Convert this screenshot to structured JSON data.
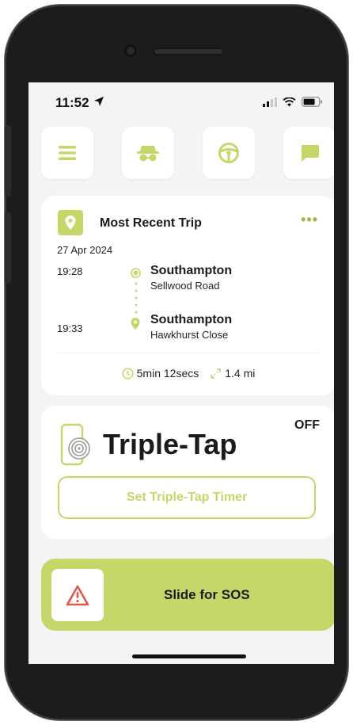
{
  "status_bar": {
    "time": "11:52",
    "location_icon": "location-arrow-icon",
    "icons": [
      "signal-icon",
      "wifi-icon",
      "battery-icon"
    ]
  },
  "top_buttons": [
    {
      "icon": "menu-icon"
    },
    {
      "icon": "incognito-icon"
    },
    {
      "icon": "steering-wheel-icon"
    },
    {
      "icon": "chat-icon"
    }
  ],
  "recent_trip": {
    "title": "Most Recent Trip",
    "date": "27 Apr 2024",
    "start": {
      "time": "19:28",
      "place": "Southampton",
      "street": "Sellwood Road"
    },
    "end": {
      "time": "19:33",
      "place": "Southampton",
      "street": "Hawkhurst Close"
    },
    "duration": "5min 12secs",
    "distance": "1.4 mi"
  },
  "triple_tap": {
    "status": "OFF",
    "title": "Triple-Tap",
    "button_label": "Set Triple-Tap Timer"
  },
  "sos": {
    "label": "Slide for SOS"
  },
  "colors": {
    "accent": "#c3d868",
    "accent_dark": "#9dbb3d",
    "background": "#f4f4f4",
    "alert_red": "#e2564d"
  }
}
